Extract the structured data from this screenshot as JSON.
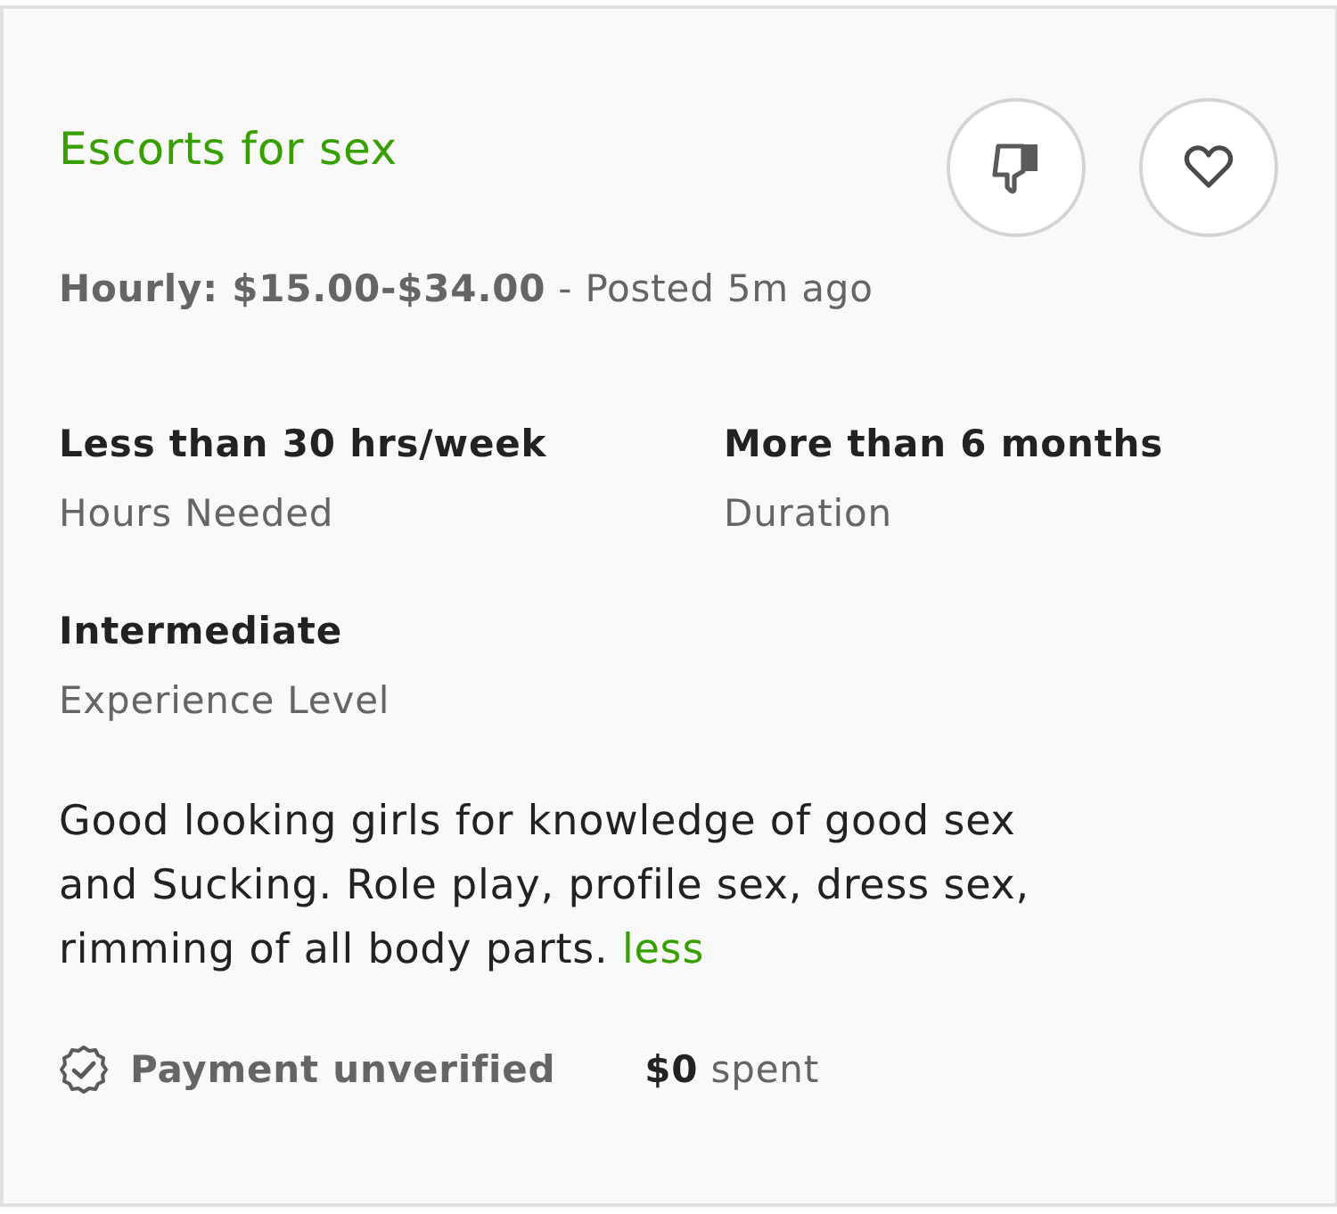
{
  "job": {
    "title": "Escorts for sex",
    "budget": {
      "rate": "Hourly: $15.00-$34.00",
      "posted": "- Posted 5m ago"
    },
    "stats": [
      {
        "value": "Less than 30 hrs/week",
        "label": "Hours Needed"
      },
      {
        "value": "More than 6 months",
        "label": "Duration"
      },
      {
        "value": "Intermediate",
        "label": "Experience Level"
      }
    ],
    "description": {
      "text": "Good looking girls for knowledge of good sex and Sucking. Role play, profile sex, dress sex, rimming of all body parts.",
      "toggle": "less"
    },
    "client": {
      "payment": "Payment unverified",
      "spent_amount": "$0",
      "spent_label": "spent"
    }
  }
}
